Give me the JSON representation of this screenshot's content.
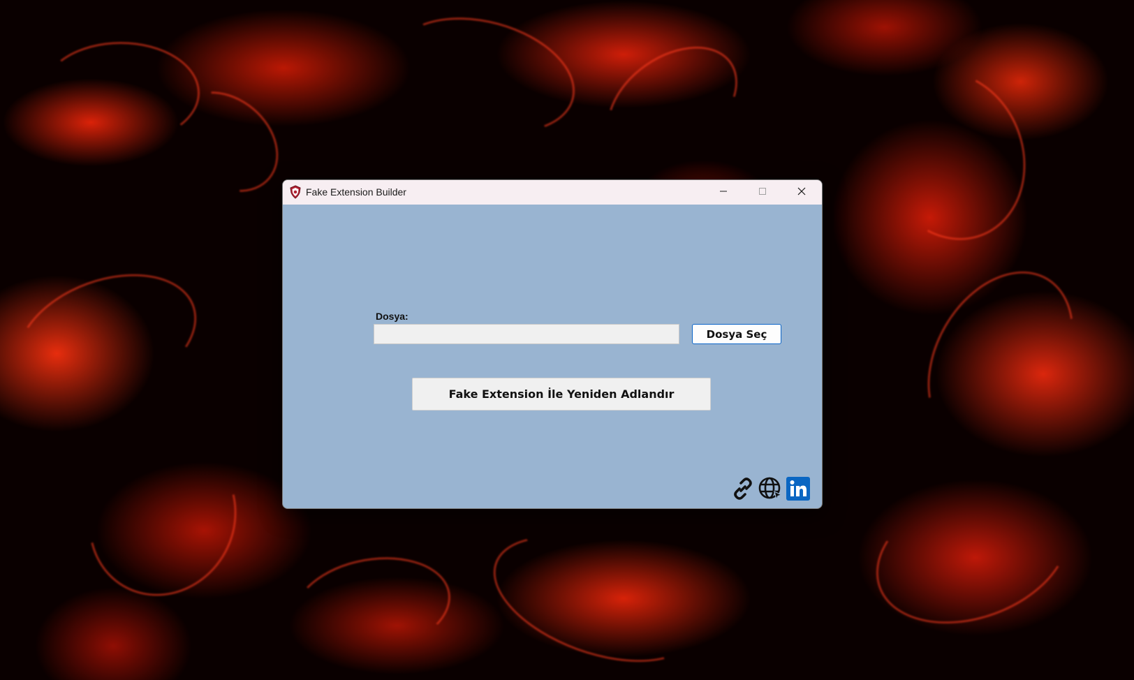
{
  "window": {
    "title": "Fake Extension Builder",
    "controls": {
      "minimize_icon": "minimize-icon",
      "maximize_icon": "maximize-icon",
      "close_icon": "close-icon"
    }
  },
  "form": {
    "file_label": "Dosya:",
    "file_value": "",
    "select_button_label": "Dosya Seç",
    "rename_button_label": "Fake Extension İle Yeniden Adlandır"
  },
  "footer_links": [
    {
      "icon": "link-icon"
    },
    {
      "icon": "globe-icon"
    },
    {
      "icon": "linkedin-icon"
    }
  ],
  "colors": {
    "window_bg": "#99b4d1",
    "titlebar_bg": "#f7eef2",
    "linkedin_blue": "#0a66c2",
    "select_button_border": "#0a64c8",
    "desktop_accent": "#ff2a0a"
  }
}
